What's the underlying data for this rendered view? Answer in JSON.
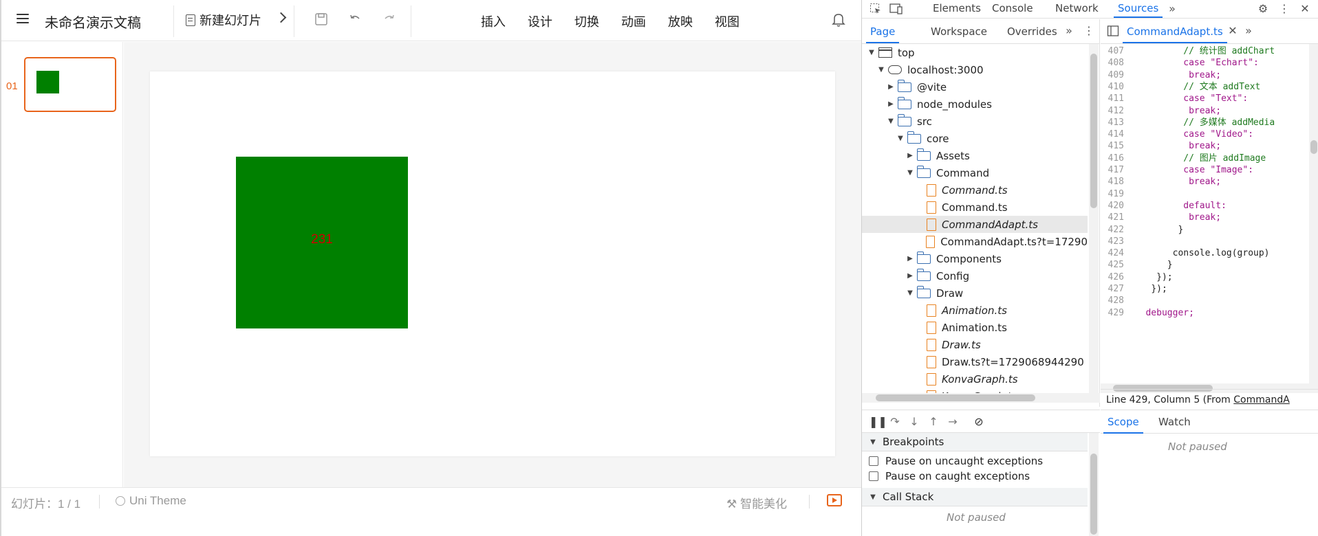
{
  "app": {
    "doc_title": "未命名演示文稿",
    "new_slide_label": "新建幻灯片",
    "menu": [
      "插入",
      "设计",
      "切换",
      "动画",
      "放映",
      "视图"
    ],
    "slide_number": "01",
    "shape_text": "231",
    "shape_color": "#008000",
    "shape_text_color": "#d00000",
    "accent_color": "#e8641b",
    "status_count": "幻灯片：1 / 1",
    "theme_label": "Uni Theme",
    "beautify_label": "智能美化"
  },
  "devtools": {
    "main_tabs": [
      "Elements",
      "Console",
      "Network",
      "Sources"
    ],
    "active_main_tab": "Sources",
    "nav_tabs": [
      "Page",
      "Workspace",
      "Overrides"
    ],
    "active_nav_tab": "Page",
    "open_file_tab": "CommandAdapt.ts",
    "tree": [
      {
        "label": "top",
        "icon": "window-icon",
        "expanded": true,
        "italic": false
      },
      {
        "label": "localhost:3000",
        "icon": "cloud-icon",
        "expanded": true,
        "italic": false
      },
      {
        "label": "@vite",
        "icon": "folder-icon",
        "expanded": false,
        "italic": false
      },
      {
        "label": "node_modules",
        "icon": "folder-icon",
        "expanded": false,
        "italic": false
      },
      {
        "label": "src",
        "icon": "folder-icon",
        "expanded": true,
        "italic": false
      },
      {
        "label": "core",
        "icon": "folder-icon",
        "expanded": true,
        "italic": false
      },
      {
        "label": "Assets",
        "icon": "folder-icon",
        "expanded": false,
        "italic": false
      },
      {
        "label": "Command",
        "icon": "folder-icon",
        "expanded": true,
        "italic": false
      },
      {
        "label": "Command.ts",
        "icon": "file-icon",
        "italic": true
      },
      {
        "label": "Command.ts",
        "icon": "file-icon",
        "italic": false
      },
      {
        "label": "CommandAdapt.ts",
        "icon": "file-icon",
        "italic": true,
        "selected": true
      },
      {
        "label": "CommandAdapt.ts?t=17290",
        "icon": "file-icon",
        "italic": false
      },
      {
        "label": "Components",
        "icon": "folder-icon",
        "expanded": false,
        "italic": false
      },
      {
        "label": "Config",
        "icon": "folder-icon",
        "expanded": false,
        "italic": false
      },
      {
        "label": "Draw",
        "icon": "folder-icon",
        "expanded": true,
        "italic": false
      },
      {
        "label": "Animation.ts",
        "icon": "file-icon",
        "italic": true
      },
      {
        "label": "Animation.ts",
        "icon": "file-icon",
        "italic": false
      },
      {
        "label": "Draw.ts",
        "icon": "file-icon",
        "italic": true
      },
      {
        "label": "Draw.ts?t=1729068944290",
        "icon": "file-icon",
        "italic": false
      },
      {
        "label": "KonvaGraph.ts",
        "icon": "file-icon",
        "italic": true
      },
      {
        "label": "KonvaGraph.ts",
        "icon": "file-icon",
        "italic": false
      }
    ],
    "code": [
      {
        "n": "407",
        "text": "// 统计图 addChart",
        "kind": "cmt"
      },
      {
        "n": "408",
        "text": "case \"Echart\":",
        "kind": "case"
      },
      {
        "n": "409",
        "text": "break;",
        "kind": "kw"
      },
      {
        "n": "410",
        "text": "// 文本 addText",
        "kind": "cmt"
      },
      {
        "n": "411",
        "text": "case \"Text\":",
        "kind": "case"
      },
      {
        "n": "412",
        "text": "break;",
        "kind": "kw"
      },
      {
        "n": "413",
        "text": "// 多媒体 addMedia",
        "kind": "cmt"
      },
      {
        "n": "414",
        "text": "case \"Video\":",
        "kind": "case"
      },
      {
        "n": "415",
        "text": "break;",
        "kind": "kw"
      },
      {
        "n": "416",
        "text": "// 图片 addImage",
        "kind": "cmt"
      },
      {
        "n": "417",
        "text": "case \"Image\":",
        "kind": "case"
      },
      {
        "n": "418",
        "text": "break;",
        "kind": "kw"
      },
      {
        "n": "419",
        "text": "",
        "kind": "plain"
      },
      {
        "n": "420",
        "text": "default:",
        "kind": "kw"
      },
      {
        "n": "421",
        "text": "break;",
        "kind": "kw"
      },
      {
        "n": "422",
        "text": "}",
        "kind": "plain"
      },
      {
        "n": "423",
        "text": "",
        "kind": "plain"
      },
      {
        "n": "424",
        "text": "console.log(group)",
        "kind": "plain"
      },
      {
        "n": "425",
        "text": "}",
        "kind": "plain"
      },
      {
        "n": "426",
        "text": "});",
        "kind": "plain"
      },
      {
        "n": "427",
        "text": "});",
        "kind": "plain"
      },
      {
        "n": "428",
        "text": "",
        "kind": "plain"
      },
      {
        "n": "429",
        "text": "debugger;",
        "kind": "kw"
      }
    ],
    "status_line": {
      "prefix": "Line 429, Column 5  (From ",
      "link": "CommandA"
    },
    "sections": {
      "breakpoints": "Breakpoints",
      "pause_uncaught": "Pause on uncaught exceptions",
      "pause_caught": "Pause on caught exceptions",
      "call_stack": "Call Stack",
      "not_paused": "Not paused"
    },
    "scope_tabs": [
      "Scope",
      "Watch"
    ],
    "active_scope_tab": "Scope",
    "scope_not_paused": "Not paused"
  }
}
